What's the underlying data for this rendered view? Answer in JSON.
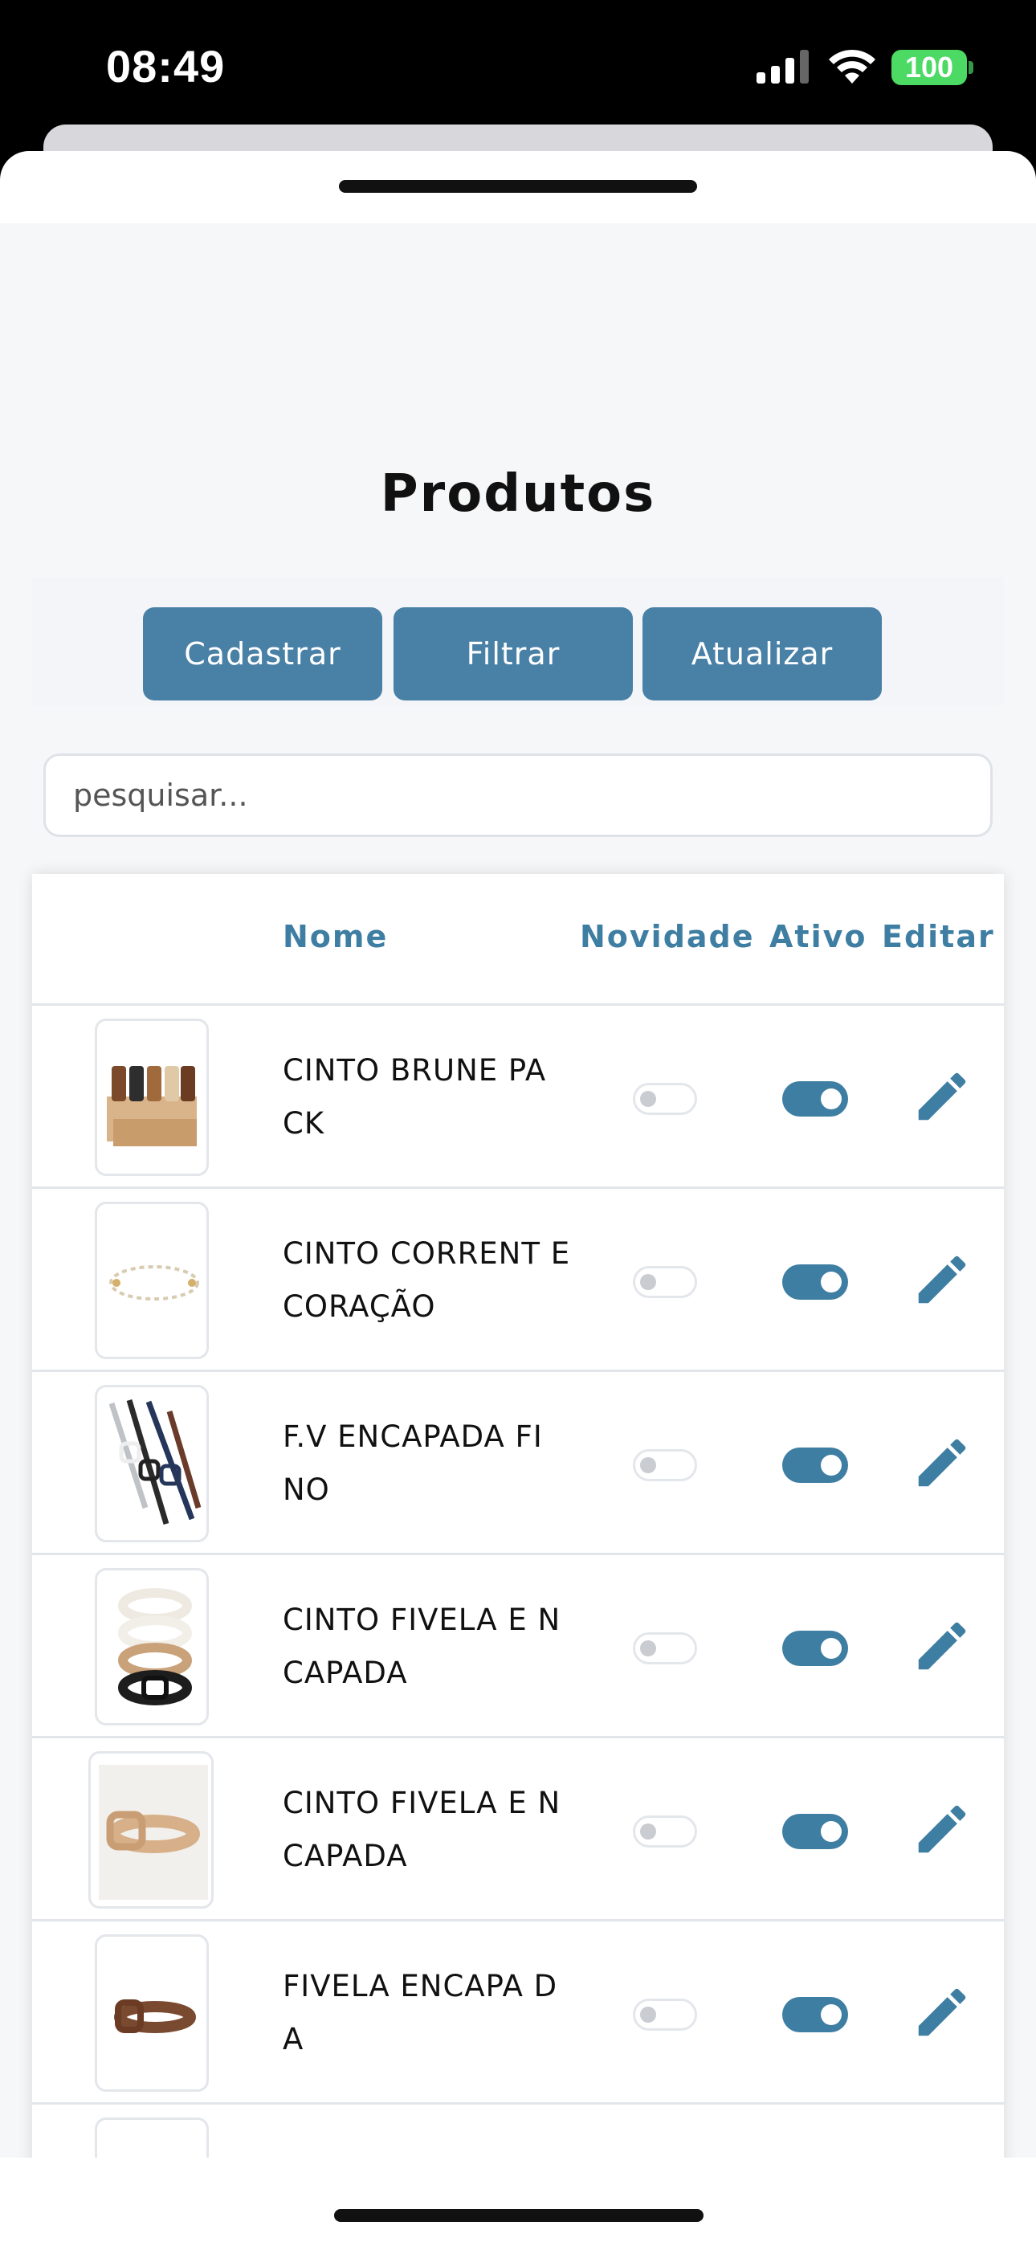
{
  "status_bar": {
    "time": "08:49",
    "battery": "100",
    "icons": [
      "signal-icon",
      "wifi-icon",
      "battery-icon"
    ]
  },
  "page": {
    "title": "Produtos"
  },
  "actions": {
    "cadastrar": "Cadastrar",
    "filtrar": "Filtrar",
    "atualizar": "Atualizar"
  },
  "search": {
    "placeholder": "pesquisar..."
  },
  "table": {
    "headers": {
      "nome": "Nome",
      "novidade": "Novidade",
      "ativo": "Ativo",
      "editar": "Editar"
    },
    "rows": [
      {
        "name": "CINTO BRUNE PA CK",
        "novidade": false,
        "ativo": true,
        "image": "belt-pack-image"
      },
      {
        "name": "CINTO CORRENT E CORAÇÃO",
        "novidade": false,
        "ativo": true,
        "image": "chain-belt-image"
      },
      {
        "name": "F.V ENCAPADA FI NO",
        "novidade": false,
        "ativo": true,
        "image": "thin-buckle-belts-image"
      },
      {
        "name": "CINTO FIVELA E NCAPADA",
        "novidade": false,
        "ativo": true,
        "image": "stacked-buckle-belts-image"
      },
      {
        "name": "CINTO FIVELA E NCAPADA",
        "novidade": false,
        "ativo": true,
        "image": "tan-buckle-belt-image"
      },
      {
        "name": "FIVELA ENCAPA DA",
        "novidade": false,
        "ativo": true,
        "image": "brown-buckle-belt-image"
      }
    ]
  },
  "colors": {
    "accent": "#4880a6",
    "header_text": "#3f7ea3",
    "background": "#f6f7f8",
    "battery": "#4cd964"
  }
}
